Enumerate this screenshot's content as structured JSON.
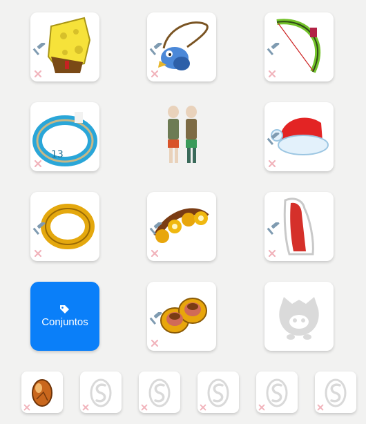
{
  "equipment": {
    "set_button_label": "Conjuntos",
    "slots": [
      {
        "id": "hat",
        "icon": "sponge-hat-icon"
      },
      {
        "id": "amulet",
        "icon": "bird-amulet-icon"
      },
      {
        "id": "weapon",
        "icon": "green-bow-icon"
      },
      {
        "id": "ring-left",
        "icon": "blue-ring-icon"
      },
      {
        "id": "character",
        "icon": "character-preview-icon"
      },
      {
        "id": "hat-2",
        "icon": "christmas-hat-icon"
      },
      {
        "id": "ring-right",
        "icon": "gold-ring-icon"
      },
      {
        "id": "belt",
        "icon": "gold-belt-icon"
      },
      {
        "id": "cape",
        "icon": "red-cape-icon"
      },
      {
        "id": "sets",
        "icon": "tag-icon"
      },
      {
        "id": "boots",
        "icon": "gold-boots-icon"
      },
      {
        "id": "pet",
        "icon": "pet-placeholder-icon"
      }
    ],
    "dofus_slots": [
      {
        "id": "dofus-1",
        "icon": "amber-egg-icon"
      },
      {
        "id": "dofus-2",
        "icon": "dofus-placeholder-icon"
      },
      {
        "id": "dofus-3",
        "icon": "dofus-placeholder-icon"
      },
      {
        "id": "dofus-4",
        "icon": "dofus-placeholder-icon"
      },
      {
        "id": "dofus-5",
        "icon": "dofus-placeholder-icon"
      },
      {
        "id": "dofus-6",
        "icon": "dofus-placeholder-icon"
      }
    ]
  },
  "colors": {
    "background": "#f2f2f1",
    "slot": "#ffffff",
    "accent": "#0a7ff9",
    "remove_cross": "#f1b3bb",
    "hammer": "#7f9bb1"
  }
}
